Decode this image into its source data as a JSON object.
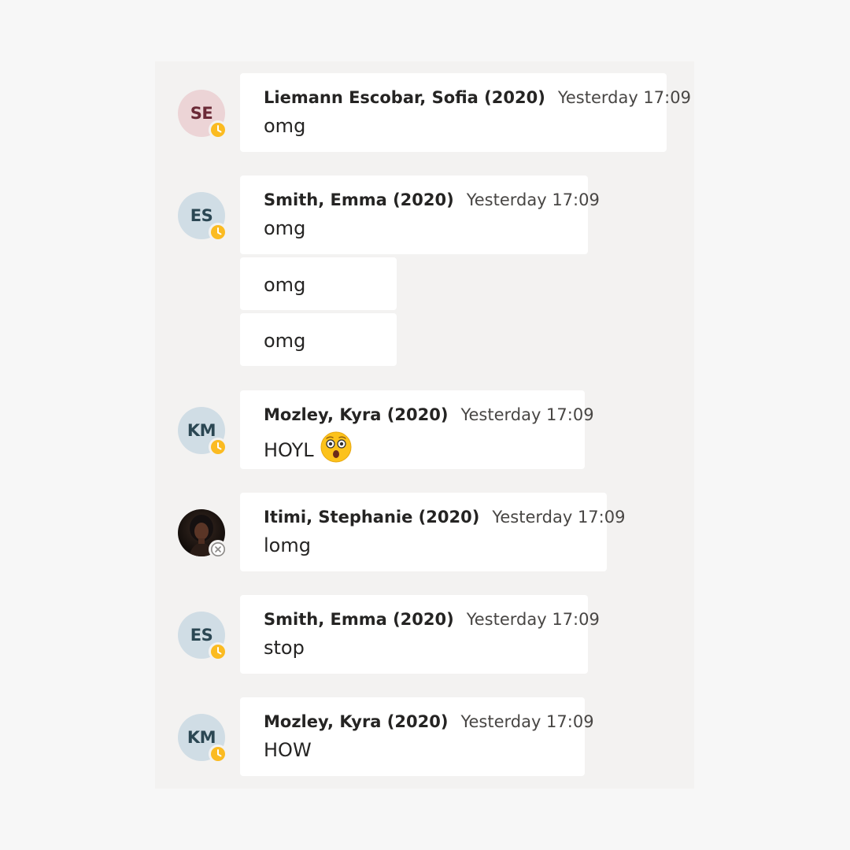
{
  "messages": [
    {
      "initials": "SE",
      "author": "Liemann Escobar, Sofia (2020)",
      "time": "Yesterday 17:09",
      "text": "omg",
      "status": "away"
    },
    {
      "initials": "ES",
      "author": "Smith, Emma (2020)",
      "time": "Yesterday 17:09",
      "text": "omg",
      "status": "away"
    },
    {
      "text": "omg"
    },
    {
      "text": "omg"
    },
    {
      "initials": "KM",
      "author": "Mozley, Kyra (2020)",
      "time": "Yesterday 17:09",
      "text": "HOYL",
      "emoji": "astonished-face-icon",
      "status": "away"
    },
    {
      "author": "Itimi, Stephanie (2020)",
      "time": "Yesterday 17:09",
      "text": "lomg",
      "avatar": "photo",
      "status": "offline"
    },
    {
      "initials": "ES",
      "author": "Smith, Emma (2020)",
      "time": "Yesterday 17:09",
      "text": "stop",
      "status": "away"
    },
    {
      "initials": "KM",
      "author": "Mozley, Kyra (2020)",
      "time": "Yesterday 17:09",
      "text": "HOW",
      "status": "away"
    }
  ],
  "colors": {
    "avatar_pink_bg": "#ecd4d6",
    "avatar_pink_text": "#6b2a37",
    "avatar_blue_bg": "#d0dde5",
    "avatar_blue_text": "#2b4753",
    "status_away": "#fbbb21"
  }
}
